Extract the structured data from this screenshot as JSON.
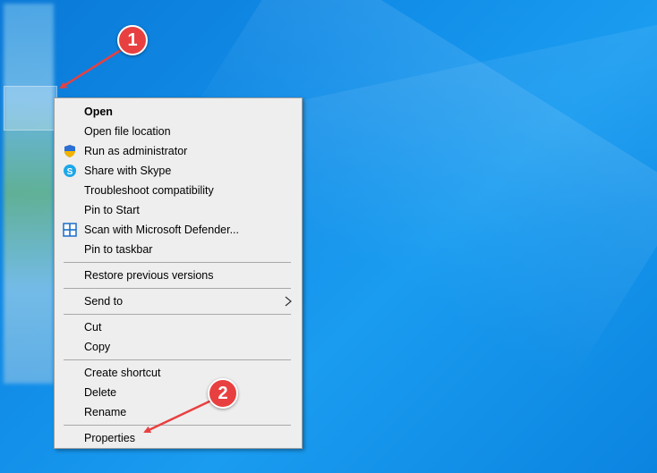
{
  "desktop": {
    "accent_color": "#0f8ae6"
  },
  "context_menu": {
    "items": [
      {
        "label": "Open",
        "bold": true
      },
      {
        "label": "Open file location"
      },
      {
        "label": "Run as administrator",
        "icon": "shield-icon"
      },
      {
        "label": "Share with Skype",
        "icon": "skype-icon"
      },
      {
        "label": "Troubleshoot compatibility"
      },
      {
        "label": "Pin to Start"
      },
      {
        "label": "Scan with Microsoft Defender...",
        "icon": "defender-icon"
      },
      {
        "label": "Pin to taskbar"
      },
      {
        "label": "Restore previous versions"
      },
      {
        "label": "Send to",
        "submenu": true
      },
      {
        "label": "Cut"
      },
      {
        "label": "Copy"
      },
      {
        "label": "Create shortcut"
      },
      {
        "label": "Delete"
      },
      {
        "label": "Rename"
      },
      {
        "label": "Properties"
      }
    ]
  },
  "annotations": {
    "callout_1": "1",
    "callout_2": "2",
    "callout_color": "#e84040"
  }
}
